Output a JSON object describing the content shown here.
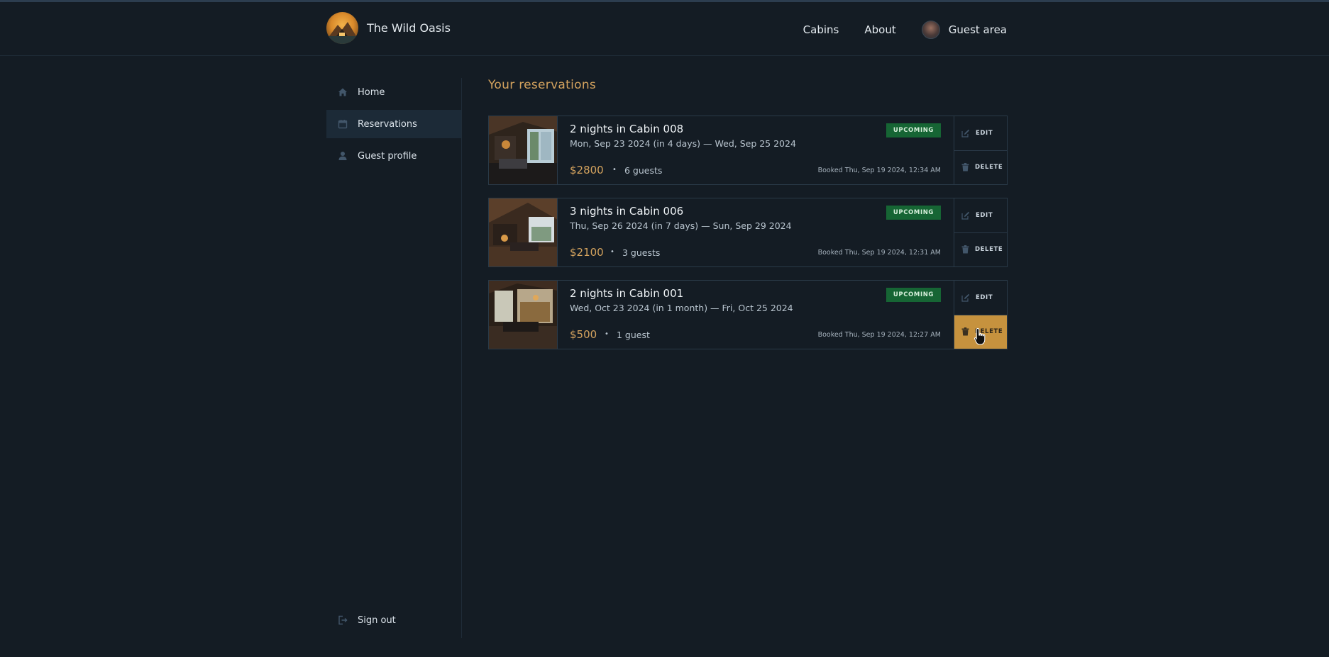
{
  "app": {
    "name": "The Wild Oasis"
  },
  "nav": {
    "cabins": "Cabins",
    "about": "About",
    "guest_area": "Guest area"
  },
  "sidebar": {
    "items": [
      {
        "label": "Home",
        "icon": "home-icon"
      },
      {
        "label": "Reservations",
        "icon": "calendar-icon",
        "active": true
      },
      {
        "label": "Guest profile",
        "icon": "user-icon"
      }
    ],
    "sign_out": "Sign out"
  },
  "page": {
    "title": "Your reservations"
  },
  "reservations": [
    {
      "title": "2 nights in Cabin 008",
      "dates": "Mon, Sep 23 2024 (in 4 days) — Wed, Sep 25 2024",
      "price": "$2800",
      "separator": "•",
      "guests": "6 guests",
      "booked": "Booked Thu, Sep 19 2024, 12:34 AM",
      "status": "UPCOMING",
      "edit": "EDIT",
      "delete": "DELETE"
    },
    {
      "title": "3 nights in Cabin 006",
      "dates": "Thu, Sep 26 2024 (in 7 days) — Sun, Sep 29 2024",
      "price": "$2100",
      "separator": "•",
      "guests": "3 guests",
      "booked": "Booked Thu, Sep 19 2024, 12:31 AM",
      "status": "UPCOMING",
      "edit": "EDIT",
      "delete": "DELETE"
    },
    {
      "title": "2 nights in Cabin 001",
      "dates": "Wed, Oct 23 2024 (in 1 month) — Fri, Oct 25 2024",
      "price": "$500",
      "separator": "•",
      "guests": "1 guest",
      "booked": "Booked Thu, Sep 19 2024, 12:27 AM",
      "status": "UPCOMING",
      "edit": "EDIT",
      "delete": "DELETE"
    }
  ],
  "colors": {
    "background": "#141c24",
    "accent": "#d4a35e",
    "badge": "#166534",
    "delete_hover": "#c6923e"
  }
}
